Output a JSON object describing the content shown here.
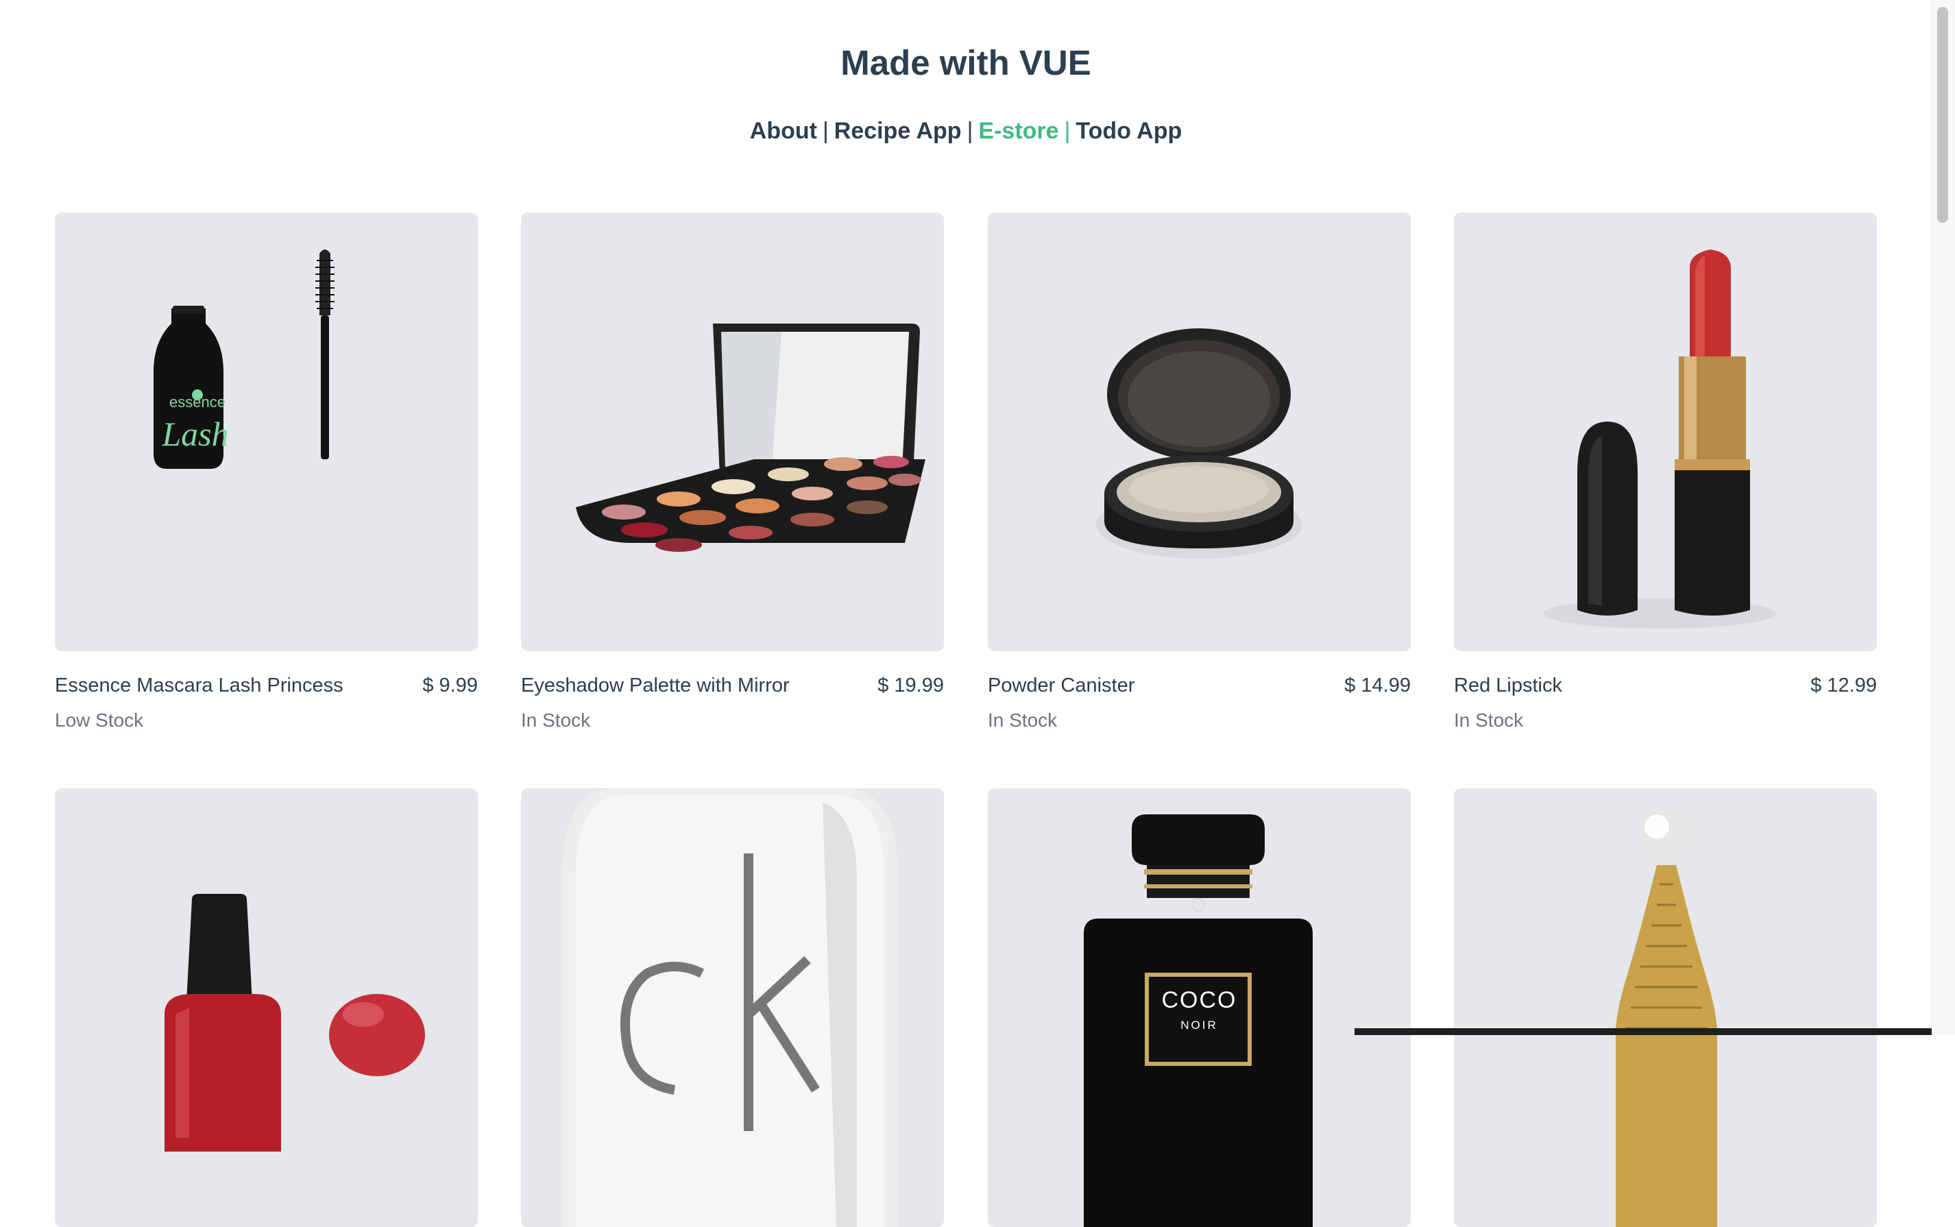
{
  "header": {
    "title": "Made with VUE"
  },
  "nav": {
    "items": [
      {
        "label": "About",
        "active": false
      },
      {
        "label": "Recipe App",
        "active": false
      },
      {
        "label": "E-store",
        "active": true
      },
      {
        "label": "Todo App",
        "active": false
      }
    ],
    "separator": "|",
    "active_color": "#42b983"
  },
  "products": [
    {
      "name": "Essence Mascara Lash Princess",
      "price": "$ 9.99",
      "stock": "Low Stock",
      "icon": "mascara-image"
    },
    {
      "name": "Eyeshadow Palette with Mirror",
      "price": "$ 19.99",
      "stock": "In Stock",
      "icon": "eyeshadow-palette-image"
    },
    {
      "name": "Powder Canister",
      "price": "$ 14.99",
      "stock": "In Stock",
      "icon": "powder-compact-image"
    },
    {
      "name": "Red Lipstick",
      "price": "$ 12.99",
      "stock": "In Stock",
      "icon": "lipstick-image"
    },
    {
      "icon": "nail-polish-image"
    },
    {
      "icon": "ck-perfume-image"
    },
    {
      "icon": "coco-noir-perfume-image",
      "label_main": "COCO",
      "label_sub": "NOIR"
    },
    {
      "icon": "gold-perfume-image"
    }
  ]
}
